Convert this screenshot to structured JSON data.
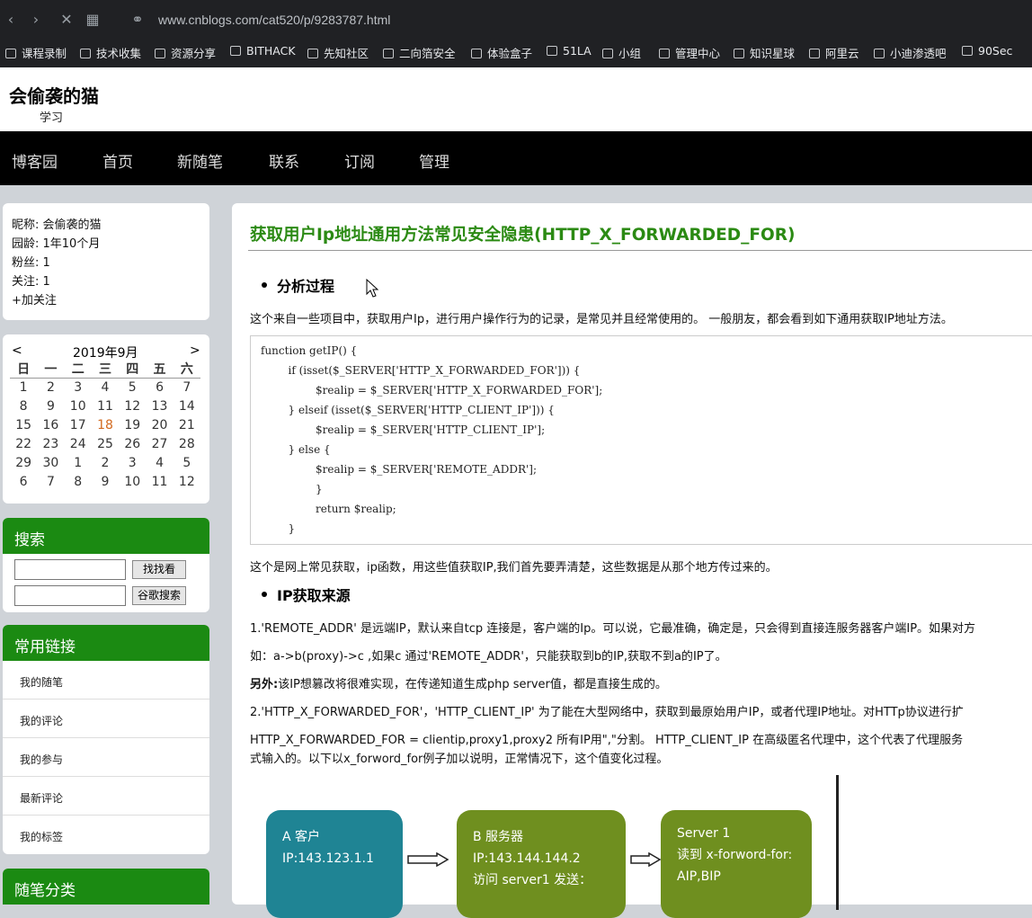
{
  "browser": {
    "url": "www.cnblogs.com/cat520/p/9283787.html",
    "bookmarks": [
      "课程录制",
      "技术收集",
      "资源分享",
      "BITHACK",
      "先知社区",
      "二向箔安全",
      "体验盒子",
      "51LA",
      "小组",
      "管理中心",
      "知识星球",
      "阿里云",
      "小迪渗透吧",
      "90Sec"
    ]
  },
  "blog": {
    "title": "会偷袭的猫",
    "subtitle": "学习"
  },
  "nav": [
    "博客园",
    "首页",
    "新随笔",
    "联系",
    "订阅",
    "管理"
  ],
  "profile": {
    "nickname": "昵称:  会偷袭的猫",
    "age": "园龄:  1年10个月",
    "fans": "粉丝:  1",
    "follow": "关注:  1",
    "add": "+加关注"
  },
  "calendar": {
    "prev": "<",
    "next": ">",
    "title": "2019年9月",
    "weekdays": [
      "日",
      "一",
      "二",
      "三",
      "四",
      "五",
      "六"
    ],
    "rows": [
      [
        "1",
        "2",
        "3",
        "4",
        "5",
        "6",
        "7"
      ],
      [
        "8",
        "9",
        "10",
        "11",
        "12",
        "13",
        "14"
      ],
      [
        "15",
        "16",
        "17",
        "18",
        "19",
        "20",
        "21"
      ],
      [
        "22",
        "23",
        "24",
        "25",
        "26",
        "27",
        "28"
      ],
      [
        "29",
        "30",
        "1",
        "2",
        "3",
        "4",
        "5"
      ],
      [
        "6",
        "7",
        "8",
        "9",
        "10",
        "11",
        "12"
      ]
    ],
    "today": "18",
    "today_color": "#d2691e"
  },
  "search": {
    "title": "搜索",
    "btn1": "找找看",
    "btn2": "谷歌搜索"
  },
  "links": {
    "title": "常用链接",
    "items": [
      "我的随笔",
      "我的评论",
      "我的参与",
      "最新评论",
      "我的标签"
    ]
  },
  "category": {
    "title": "随笔分类"
  },
  "post": {
    "title": "获取用户Ip地址通用方法常见安全隐患(HTTP_X_FORWARDED_FOR)",
    "h_analysis": "分析过程",
    "p1": "这个来自一些项目中，获取用户Ip，进行用户操作行为的记录，是常见并且经常使用的。 一般朋友，都会看到如下通用获取IP地址方法。",
    "code": [
      "function getIP() {",
      "        if (isset($_SERVER['HTTP_X_FORWARDED_FOR'])) {",
      "                $realip = $_SERVER['HTTP_X_FORWARDED_FOR'];",
      "        } elseif (isset($_SERVER['HTTP_CLIENT_IP'])) {",
      "                $realip = $_SERVER['HTTP_CLIENT_IP'];",
      "        } else {",
      "                $realip = $_SERVER['REMOTE_ADDR'];",
      "                }",
      "                return $realip;",
      "        }"
    ],
    "p2": "这个是网上常见获取，ip函数，用这些值获取IP,我们首先要弄清楚，这些数据是从那个地方传过来的。",
    "h_source": "IP获取来源",
    "p3": "1.'REMOTE_ADDR' 是远端IP，默认来自tcp 连接是，客户端的Ip。可以说，它最准确，确定是，只会得到直接连服务器客户端IP。如果对方",
    "p4": "如：a->b(proxy)->c ,如果c 通过'REMOTE_ADDR'，只能获取到b的IP,获取不到a的IP了。",
    "p5_bold": "另外:",
    "p5": "该IP想篡改将很难实现，在传递知道生成php server值，都是直接生成的。",
    "p6": "2.'HTTP_X_FORWARDED_FOR'，'HTTP_CLIENT_IP' 为了能在大型网络中，获取到最原始用户IP，或者代理IP地址。对HTTp协议进行扩",
    "p7": "HTTP_X_FORWARDED_FOR = clientip,proxy1,proxy2  所有IP用\",\"分割。 HTTP_CLIENT_IP 在高级匿名代理中，这个代表了代理服务",
    "p8": "式输入的。以下以x_forword_for例子加以说明，正常情况下，这个值变化过程。"
  },
  "diagram": {
    "a1": "A 客户",
    "a2": "IP:143.123.1.1",
    "b1": "B 服务器",
    "b2": "IP:143.144.144.2",
    "b3": "访问 server1 发送：",
    "s1": "Server 1",
    "s2": "读到 x-forword-for:",
    "s3": "AIP,BIP"
  }
}
